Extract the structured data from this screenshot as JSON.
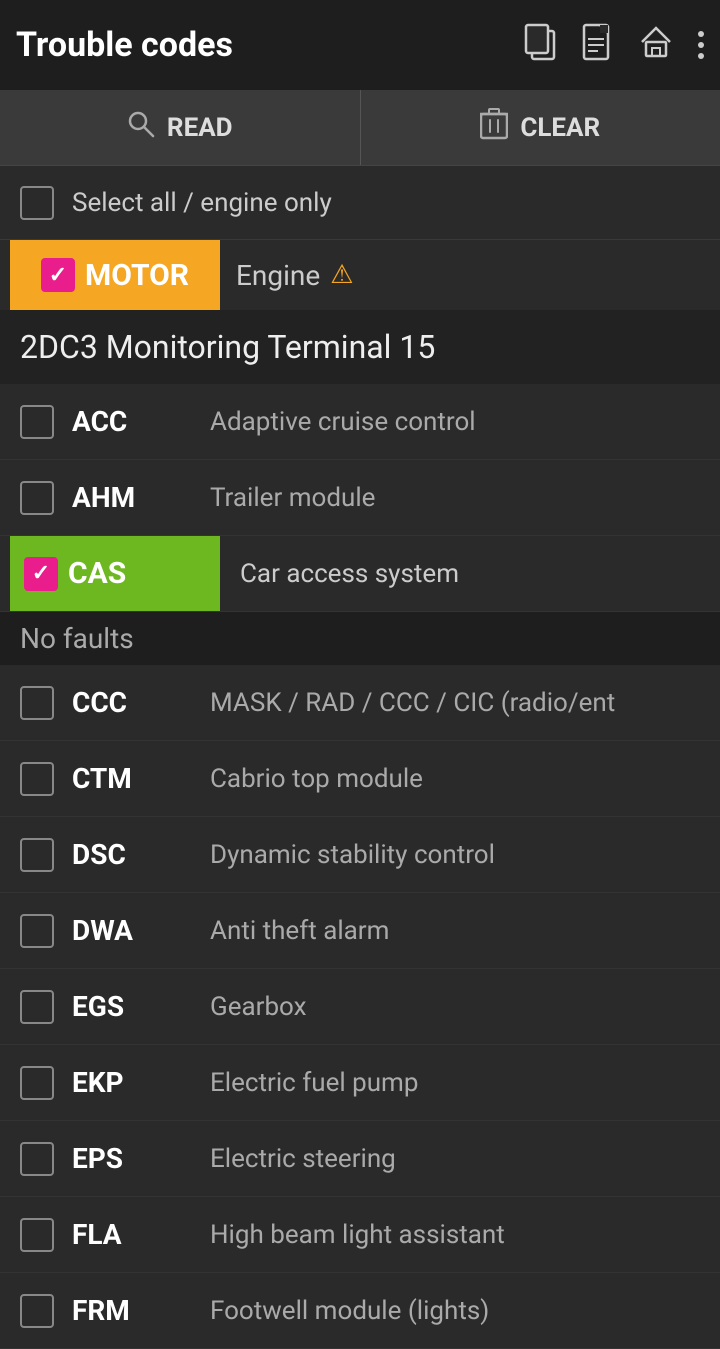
{
  "header": {
    "title": "Trouble codes",
    "icons": {
      "copy": "⧉",
      "doc": "🗋",
      "home": "⌂",
      "more": "⋮"
    }
  },
  "toolbar": {
    "read_label": "READ",
    "clear_label": "CLEAR"
  },
  "select_all": {
    "label": "Select all / engine only",
    "checked": false
  },
  "motor": {
    "tag": "MOTOR",
    "description": "Engine",
    "checked": true
  },
  "section": {
    "title": "2DC3 Monitoring Terminal 15"
  },
  "modules": [
    {
      "code": "ACC",
      "description": "Adaptive cruise control",
      "checked": false,
      "highlighted": false,
      "cas": false
    },
    {
      "code": "AHM",
      "description": "Trailer module",
      "checked": false,
      "highlighted": false,
      "cas": false
    },
    {
      "code": "CAS",
      "description": "Car access system",
      "checked": true,
      "highlighted": true,
      "cas": true
    },
    {
      "code": "CCC",
      "description": "MASK / RAD / CCC / CIC (radio/ent",
      "checked": false,
      "highlighted": false,
      "cas": false
    },
    {
      "code": "CTM",
      "description": "Cabrio top module",
      "checked": false,
      "highlighted": false,
      "cas": false
    },
    {
      "code": "DSC",
      "description": "Dynamic stability control",
      "checked": false,
      "highlighted": false,
      "cas": false
    },
    {
      "code": "DWA",
      "description": "Anti theft alarm",
      "checked": false,
      "highlighted": false,
      "cas": false
    },
    {
      "code": "EGS",
      "description": "Gearbox",
      "checked": false,
      "highlighted": false,
      "cas": false
    },
    {
      "code": "EKP",
      "description": "Electric fuel pump",
      "checked": false,
      "highlighted": false,
      "cas": false
    },
    {
      "code": "EPS",
      "description": "Electric steering",
      "checked": false,
      "highlighted": false,
      "cas": false
    },
    {
      "code": "FLA",
      "description": "High beam light assistant",
      "checked": false,
      "highlighted": false,
      "cas": false
    },
    {
      "code": "FRM",
      "description": "Footwell module (lights)",
      "checked": false,
      "highlighted": false,
      "cas": false
    }
  ],
  "no_faults": "No faults"
}
